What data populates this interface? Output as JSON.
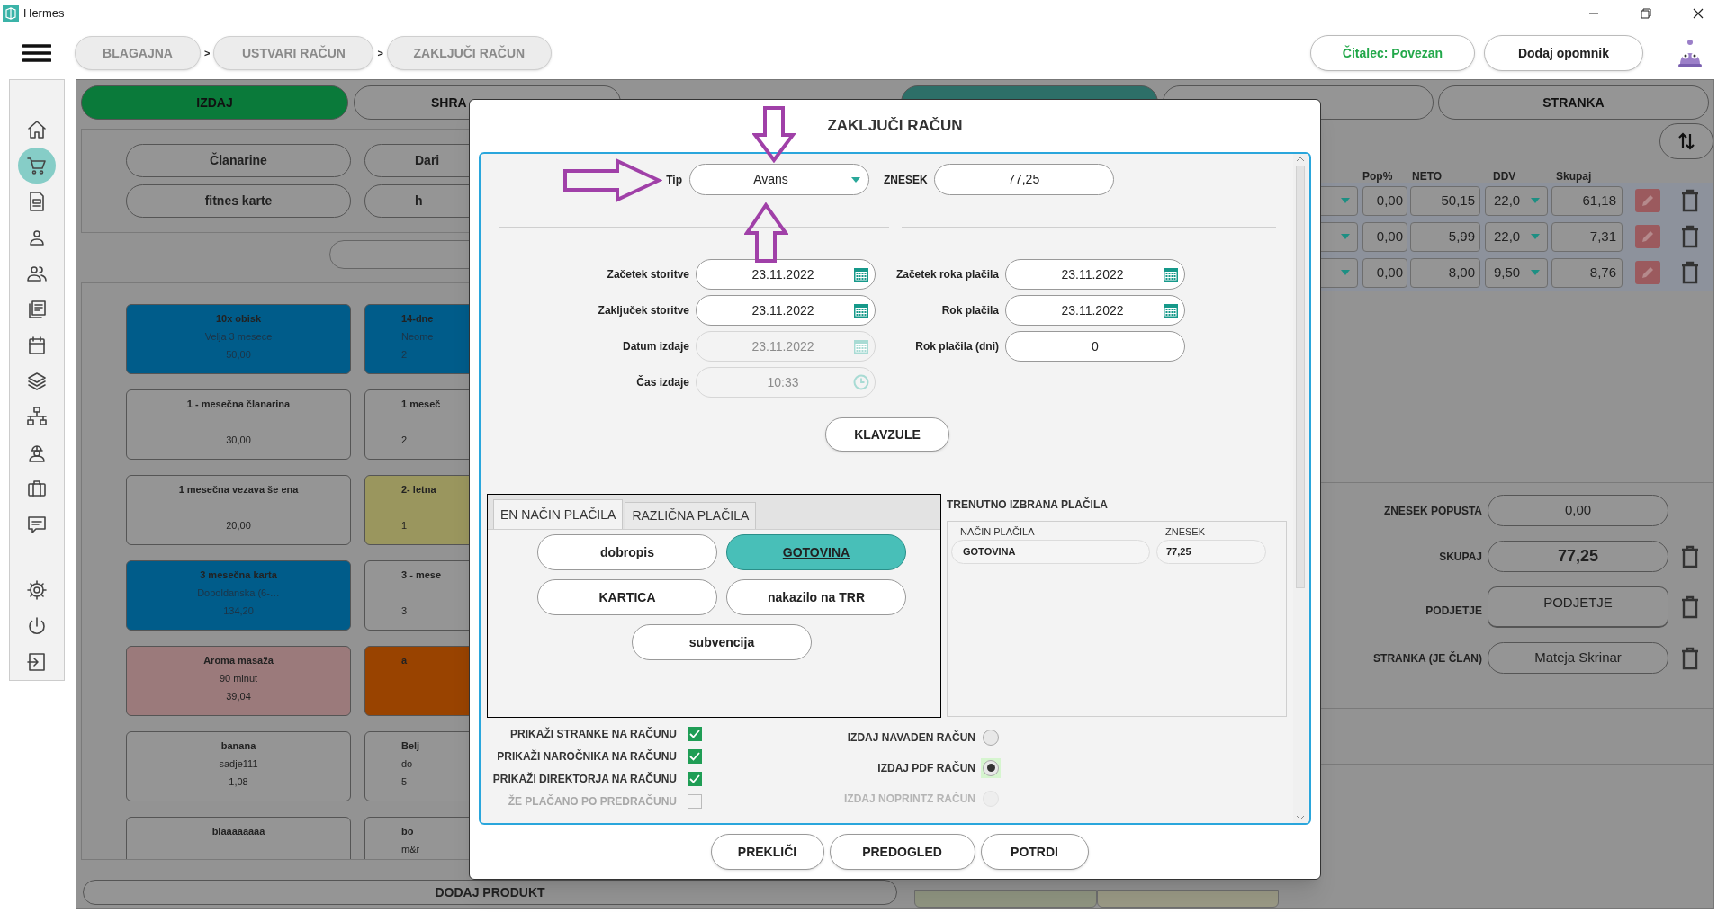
{
  "window": {
    "title": "Hermes"
  },
  "top_bar": {
    "breadcrumbs": [
      "BLAGAJNA",
      "USTVARI RAČUN",
      "ZAKLJUČI RAČUN"
    ],
    "separators": [
      ">",
      ">"
    ],
    "reader_status": "Čitalec: Povezan",
    "reminder_button": "Dodaj opomnik"
  },
  "sidebar": {
    "items": [
      {
        "selected": false
      },
      {
        "selected": true
      },
      {
        "selected": false
      },
      {
        "selected": false
      },
      {
        "selected": false
      },
      {
        "selected": false
      },
      {
        "selected": false
      },
      {
        "selected": false
      },
      {
        "selected": false
      },
      {
        "selected": false
      },
      {
        "selected": false
      },
      {
        "selected": false
      },
      {
        "selected": false
      },
      {
        "selected": false
      },
      {
        "selected": false
      }
    ]
  },
  "sale_panel": {
    "tabs": [
      {
        "label": "IZDAJ",
        "selected": true
      },
      {
        "label": "SHRA",
        "selected": false
      }
    ],
    "categories": [
      "Članarine",
      "Dari",
      "fitnes karte",
      "h"
    ],
    "products": [
      {
        "name": "10x obisk",
        "note": "Velja 3 mesece",
        "price": "50,00",
        "color": "#005c8a"
      },
      {
        "name": "14-dne",
        "note": "Neome",
        "price": "2",
        "color": "#005c8a"
      },
      {
        "name": "1 - mesečna članarina",
        "price": "30,00",
        "color": "#959595"
      },
      {
        "name": "1 meseč",
        "price": "2",
        "color": "#959595"
      },
      {
        "name": "1 mesečna vezava še ena",
        "price": "20,00",
        "color": "#959595"
      },
      {
        "name": "2- letna",
        "price": "1",
        "color": "#9a965e"
      },
      {
        "name": "3 mesečna karta",
        "note": "Dopoldanska (6-…",
        "price": "134,20",
        "color": "#005c8a"
      },
      {
        "name": "3 - mese",
        "price": "3",
        "color": "#959595"
      },
      {
        "name": "Aroma masaža",
        "note": "90 minut",
        "price": "39,04",
        "color": "#9b7a7b"
      },
      {
        "name": "a",
        "color": "#994300"
      },
      {
        "name": "banana",
        "note": "sadje111",
        "price": "1,08",
        "color": "#959595"
      },
      {
        "name": "Belj",
        "note": "do",
        "price": "5",
        "color": "#959595"
      },
      {
        "name": "blaaaaaaaa",
        "color": "#959595"
      },
      {
        "name": "bo",
        "note": "m&r",
        "color": "#959595"
      }
    ],
    "bottom_button": "DODAJ PRODUKT"
  },
  "invoice_panel": {
    "tabs": [
      {
        "selected": true
      },
      {
        "selected": false
      },
      {
        "label": "STRANKA",
        "selected": false
      }
    ],
    "table": {
      "columns": [
        "Pop%",
        "NETO",
        "DDV",
        "Skupaj"
      ],
      "rows": [
        {
          "discount": "0,00",
          "net": "50,15",
          "vat": "22,0",
          "total": "61,18"
        },
        {
          "discount": "0,00",
          "net": "5,99",
          "vat": "22,0",
          "total": "7,31"
        },
        {
          "discount": "0,00",
          "net": "8,00",
          "vat": "9,50",
          "total": "8,76"
        }
      ]
    },
    "summary": [
      {
        "label": "ZNESEK POPUSTA",
        "value": "0,00",
        "kind": "field",
        "deletable": false
      },
      {
        "label": "SKUPAJ",
        "value": "77,25",
        "kind": "total",
        "deletable": true
      },
      {
        "label": "PODJETJE",
        "value": "PODJETJE",
        "kind": "button",
        "deletable": true
      },
      {
        "label": "STRANKA (JE ČLAN)",
        "value": "Mateja Skrinar",
        "kind": "field",
        "deletable": true
      }
    ]
  },
  "dialog": {
    "title": "ZAKLJUČI RAČUN",
    "type_field": {
      "label": "Tip",
      "value": "Avans"
    },
    "amount_field": {
      "label": "ZNESEK",
      "value": "77,25"
    },
    "left_fields": [
      {
        "label": "Začetek storitve",
        "value": "23.11.2022",
        "kind": "date",
        "disabled": false
      },
      {
        "label": "Zaključek storitve",
        "value": "23.11.2022",
        "kind": "date",
        "disabled": false
      },
      {
        "label": "Datum izdaje",
        "value": "23.11.2022",
        "kind": "date",
        "disabled": true
      },
      {
        "label": "Čas izdaje",
        "value": "10:33",
        "kind": "time",
        "disabled": true
      }
    ],
    "right_fields": [
      {
        "label": "Začetek roka plačila",
        "value": "23.11.2022",
        "kind": "date",
        "disabled": false
      },
      {
        "label": "Rok plačila",
        "value": "23.11.2022",
        "kind": "date",
        "disabled": false
      },
      {
        "label": "Rok plačila (dni)",
        "value": "0",
        "kind": "number",
        "disabled": false
      }
    ],
    "clauses_button": "KLAVZULE",
    "payment_tabs": [
      {
        "label": "EN NAČIN PLAČILA",
        "selected": true
      },
      {
        "label": "RAZLIČNA PLAČILA",
        "selected": false
      }
    ],
    "payment_methods": [
      {
        "label": "dobropis",
        "selected": false
      },
      {
        "label": "GOTOVINA",
        "selected": true
      },
      {
        "label": "KARTICA",
        "selected": false
      },
      {
        "label": "nakazilo na TRR",
        "selected": false
      },
      {
        "label": "subvencija",
        "selected": false
      }
    ],
    "selected_payments": {
      "title": "TRENUTNO IZBRANA PLAČILA",
      "columns": [
        "NAČIN PLAČILA",
        "ZNESEK"
      ],
      "rows": [
        {
          "method": "GOTOVINA",
          "amount": "77,25"
        }
      ]
    },
    "checkboxes": [
      {
        "label": "PRIKAŽI STRANKE NA RAČUNU",
        "checked": true,
        "disabled": false
      },
      {
        "label": "PRIKAŽI NAROČNIKA NA RAČUNU",
        "checked": true,
        "disabled": false
      },
      {
        "label": "PRIKAŽI DIREKTORJA NA RAČUNU",
        "checked": true,
        "disabled": false
      },
      {
        "label": "ŽE PLAČANO PO PREDRAČUNU",
        "checked": false,
        "disabled": true
      }
    ],
    "print_options": [
      {
        "label": "IZDAJ NAVADEN RAČUN",
        "selected": false,
        "disabled": false
      },
      {
        "label": "IZDAJ PDF RAČUN",
        "selected": true,
        "disabled": false
      },
      {
        "label": "IZDAJ NOPRINTZ RAČUN",
        "selected": false,
        "disabled": true
      }
    ],
    "buttons": [
      "PREKLIČI",
      "PREDOGLED",
      "POTRDI"
    ]
  }
}
